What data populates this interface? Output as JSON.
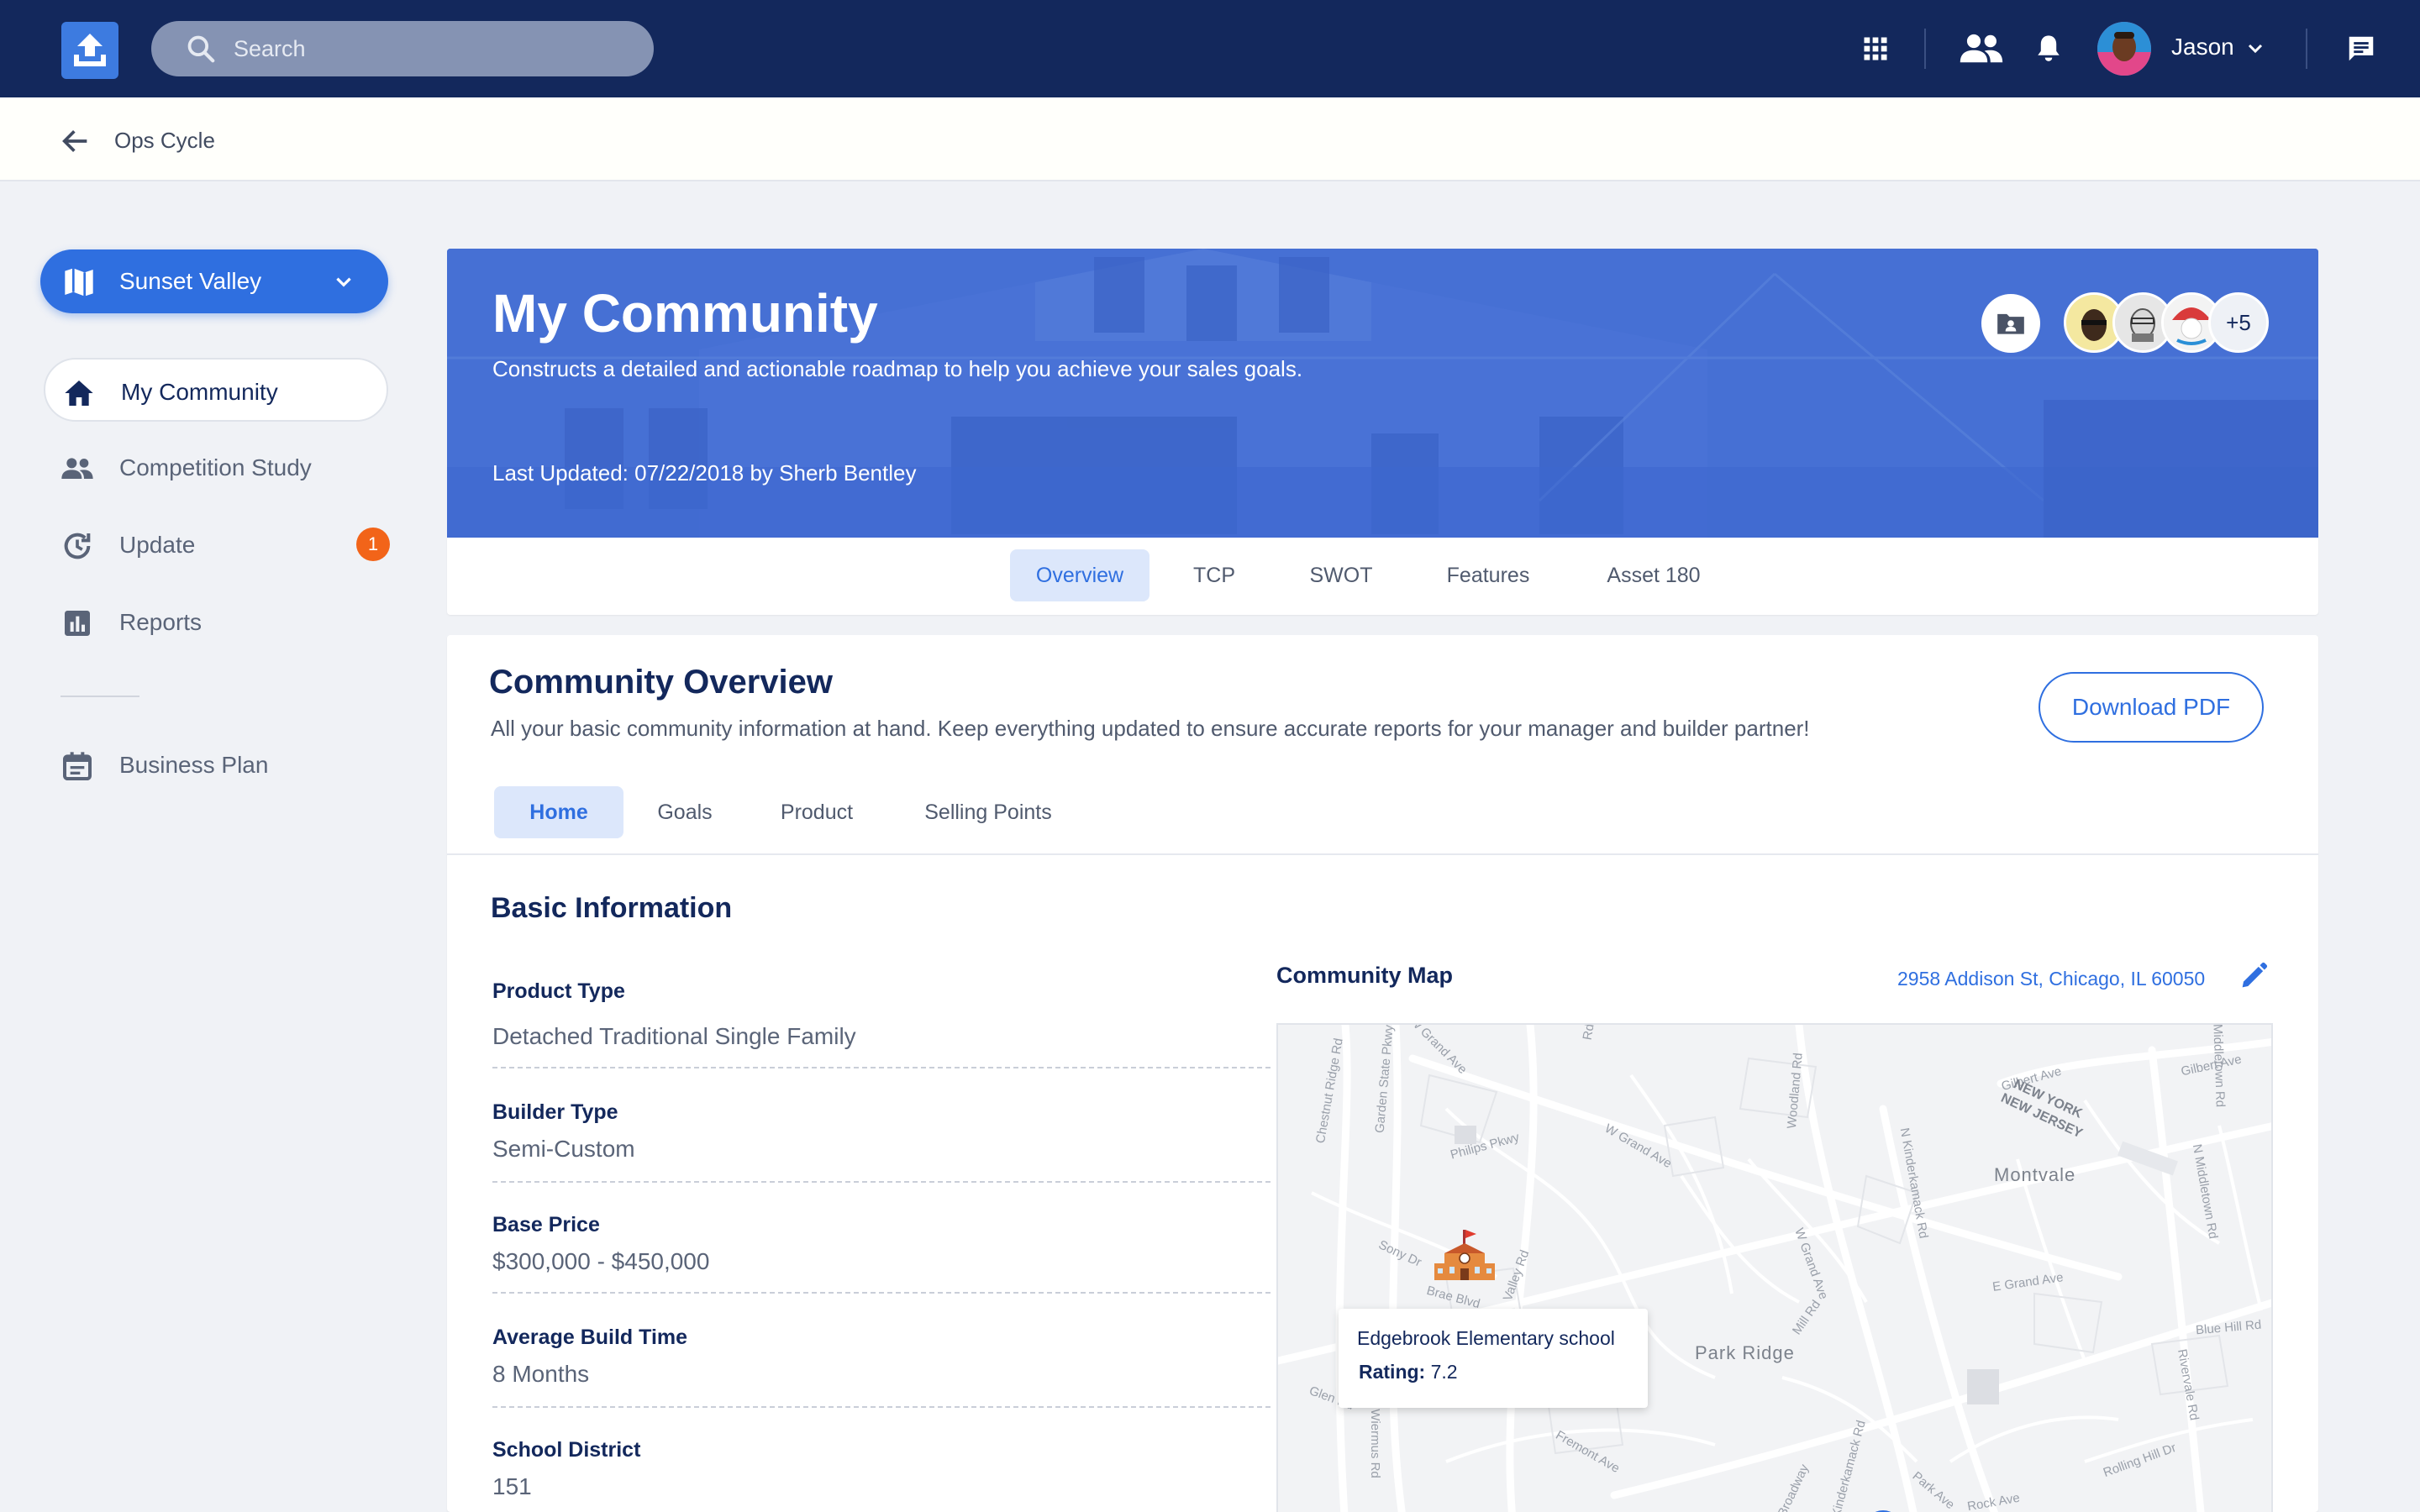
{
  "topbar": {
    "search_placeholder": "Search",
    "user_name": "Jason"
  },
  "breadcrumb": {
    "label": "Ops Cycle"
  },
  "sidebar": {
    "community": "Sunset Valley",
    "items": [
      {
        "label": "My Community"
      },
      {
        "label": "Competition Study"
      },
      {
        "label": "Update",
        "badge": "1"
      },
      {
        "label": "Reports"
      },
      {
        "label": "Business Plan"
      }
    ]
  },
  "hero": {
    "title": "My Community",
    "subtitle": "Constructs a detailed and actionable roadmap to help you achieve your sales goals.",
    "updated": "Last Updated: 07/22/2018 by Sherb Bentley",
    "more_members": "+5"
  },
  "tabs": [
    "Overview",
    "TCP",
    "SWOT",
    "Features",
    "Asset 180"
  ],
  "overview": {
    "title": "Community Overview",
    "subtitle": "All your basic community information at hand. Keep everything updated to ensure accurate reports for your manager and builder partner!",
    "download_label": "Download PDF",
    "subtabs": [
      "Home",
      "Goals",
      "Product",
      "Selling Points"
    ],
    "section_title": "Basic Information",
    "fields": [
      {
        "label": "Product Type",
        "value": "Detached Traditional Single Family"
      },
      {
        "label": "Builder Type",
        "value": "Semi-Custom"
      },
      {
        "label": "Base Price",
        "value": "$300,000 - $450,000"
      },
      {
        "label": "Average Build Time",
        "value": "8 Months"
      },
      {
        "label": "School District",
        "value": "151"
      }
    ]
  },
  "map": {
    "title": "Community Map",
    "address": "2958 Addison St, Chicago, IL 60050",
    "popup_name": "Edgebrook Elementary school",
    "popup_rating_label": "Rating:",
    "popup_rating_value": "7.2",
    "towns": [
      "Montvale",
      "Park Ridge"
    ],
    "streets": [
      "W Grand Ave",
      "Chestnut Ridge Rd",
      "Garden State Pkwy",
      "Philips Pkwy",
      "W Grand Ave",
      "Woodland Rd",
      "Gilbert Ave",
      "Gilbert Ave",
      "N Kinderkamack Rd",
      "N Middletown Rd",
      "Middletown Rd",
      "Sony Dr",
      "Valley Rd",
      "Brae Blvd",
      "W Grand Ave",
      "E Grand Ave",
      "Mill Rd",
      "Blue Hill Rd",
      "Rivervale Rd",
      "Glen Rd",
      "Wiermus Rd",
      "Fremont Ave",
      "Broadway",
      "Kinderkamack Rd",
      "Park Ave",
      "Rock Ave",
      "Rolling Hill Dr",
      "Rd",
      "NEW YORK",
      "NEW JERSEY"
    ]
  },
  "colors": {
    "topbar": "#13285c",
    "accent": "#2f6fe0",
    "badge": "#f26419",
    "hero": "#3f6bd1"
  }
}
